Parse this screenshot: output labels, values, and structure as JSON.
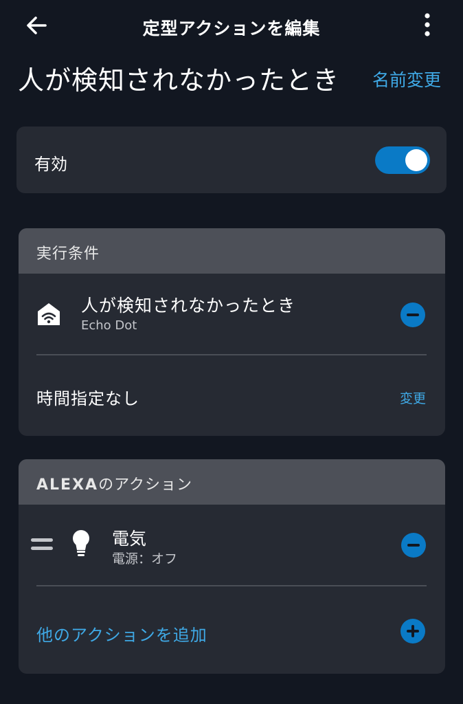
{
  "header": {
    "title": "定型アクションを編集",
    "back_icon": "arrow-left-icon",
    "more_icon": "more-vertical-icon"
  },
  "routine": {
    "name": "人が検知されなかったとき",
    "rename_label": "名前変更"
  },
  "enabled_card": {
    "label": "有効",
    "toggle_on": true
  },
  "trigger_card": {
    "header": "実行条件",
    "trigger": {
      "icon": "smart-home-wifi-icon",
      "title": "人が検知されなかったとき",
      "subtitle": "Echo Dot"
    },
    "schedule_label": "時間指定なし",
    "change_label": "変更"
  },
  "actions_card": {
    "header_brand": "ALEXA",
    "header_rest": "のアクション",
    "action": {
      "icon": "light-bulb-icon",
      "title": "電気",
      "subtitle": "電源：オフ"
    },
    "add_label": "他のアクションを追加"
  },
  "colors": {
    "background": "#121721",
    "card": "#262a33",
    "card_header": "#4d5058",
    "accent": "#0a7ac6",
    "link": "#3fa9e6"
  }
}
